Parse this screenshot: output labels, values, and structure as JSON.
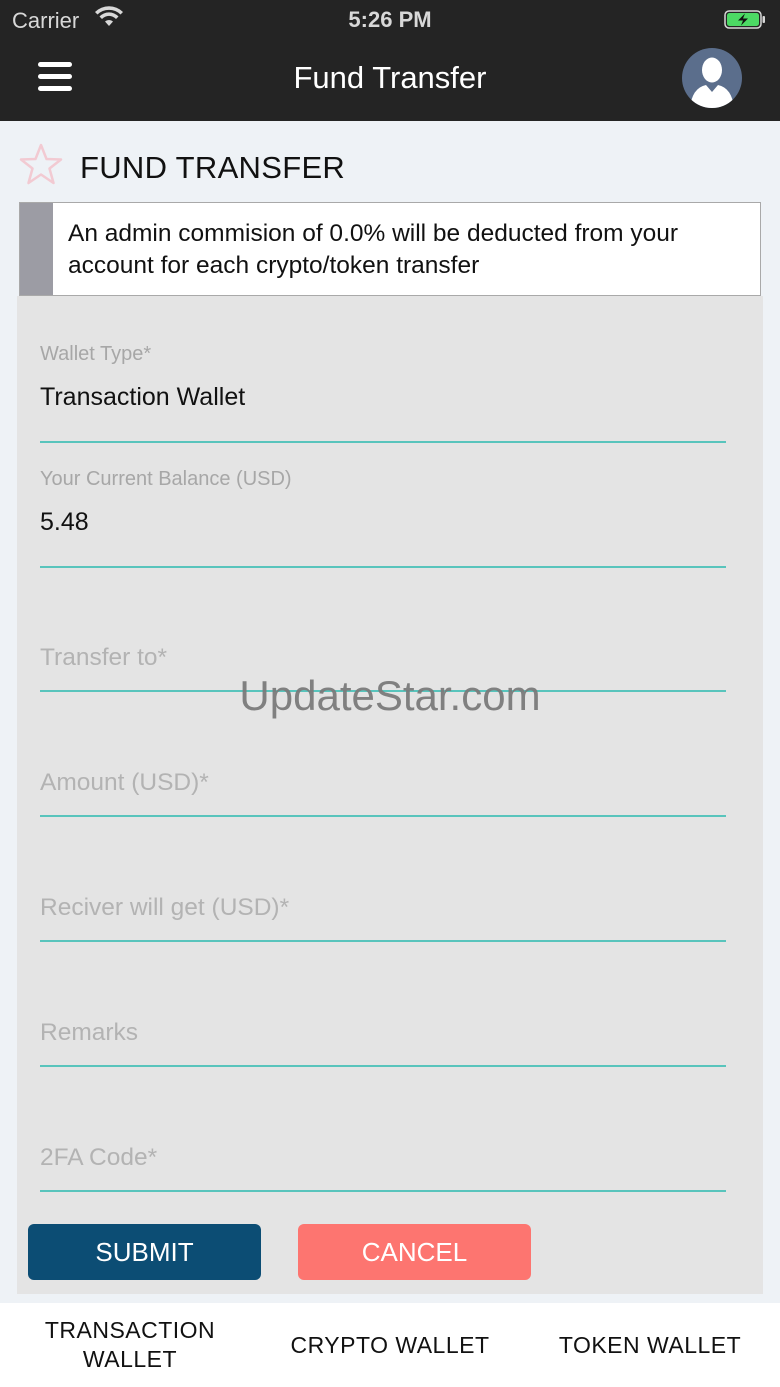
{
  "status_bar": {
    "carrier": "Carrier",
    "time": "5:26 PM"
  },
  "nav": {
    "title": "Fund Transfer"
  },
  "section": {
    "heading": "FUND TRANSFER"
  },
  "notice": {
    "text": "An admin commision of 0.0% will be deducted from your account for each crypto/token transfer"
  },
  "form": {
    "wallet_type": {
      "label": "Wallet Type*",
      "value": "Transaction Wallet"
    },
    "balance": {
      "label": "Your Current Balance (USD)",
      "value": "5.48"
    },
    "transfer_to": {
      "placeholder": "Transfer to*"
    },
    "amount": {
      "placeholder": "Amount (USD)*"
    },
    "receiver_gets": {
      "placeholder": "Reciver will get (USD)*"
    },
    "remarks": {
      "placeholder": "Remarks"
    },
    "twofa": {
      "placeholder": "2FA Code*"
    },
    "submit_label": "SUBMIT",
    "cancel_label": "CANCEL"
  },
  "watermark": "UpdateStar.com",
  "tabs": [
    {
      "label": "TRANSACTION WALLET"
    },
    {
      "label": "CRYPTO WALLET"
    },
    {
      "label": "TOKEN WALLET"
    }
  ],
  "colors": {
    "nav_bg": "#242424",
    "accent_line": "#58c4bc",
    "submit": "#0c4d74",
    "cancel": "#fd7570",
    "form_bg": "#e4e4e4",
    "page_bg": "#eef2f6"
  },
  "icons": {
    "menu": "hamburger-icon",
    "profile": "user-avatar-icon",
    "star": "star-outline-icon",
    "wifi": "wifi-icon",
    "battery": "battery-charging-icon"
  }
}
